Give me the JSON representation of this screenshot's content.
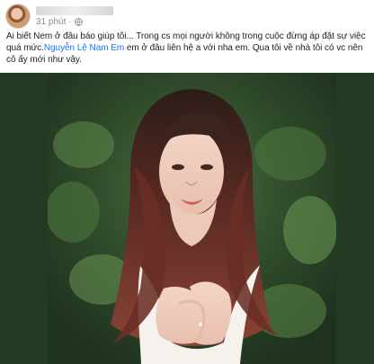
{
  "post": {
    "author": {
      "name": ""
    },
    "time_ago": "31 phút",
    "privacy_icon": "globe-icon",
    "caption_before_mention": "Ai biết Nem ở đâu báo giúp tôi... Trong cs mọi người không trong cuộc đừng áp đặt sự việc quá mức.",
    "mention_name": "Nguyễn Lệ Nam Em",
    "caption_after_mention": " em ở đâu liên hệ a với nha em. Qua tôi về nhà tôi có vc nên cô ấy mới như vậy.",
    "accent_color": "#1877f2"
  }
}
